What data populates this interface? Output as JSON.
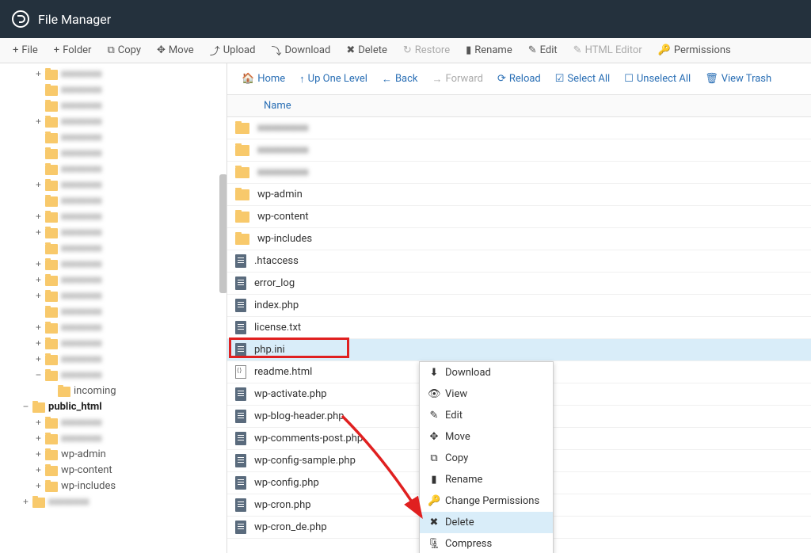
{
  "header": {
    "title": "File Manager"
  },
  "toolbar": {
    "items": [
      {
        "icon": "+",
        "label": "File"
      },
      {
        "icon": "+",
        "label": "Folder"
      },
      {
        "icon": "⧉",
        "label": "Copy"
      },
      {
        "icon": "✥",
        "label": "Move"
      },
      {
        "icon": "⤴",
        "label": "Upload"
      },
      {
        "icon": "⤵",
        "label": "Download"
      },
      {
        "icon": "✖",
        "label": "Delete"
      },
      {
        "icon": "↻",
        "label": "Restore",
        "disabled": true
      },
      {
        "icon": "▮",
        "label": "Rename"
      },
      {
        "icon": "✎",
        "label": "Edit"
      },
      {
        "icon": "✎",
        "label": "HTML Editor",
        "disabled": true
      },
      {
        "icon": "🔑",
        "label": "Permissions"
      }
    ]
  },
  "actionbar": {
    "items": [
      {
        "icon": "🏠",
        "label": "Home"
      },
      {
        "icon": "↑",
        "label": "Up One Level"
      },
      {
        "icon": "←",
        "label": "Back"
      },
      {
        "icon": "→",
        "label": "Forward",
        "disabled": true
      },
      {
        "icon": "⟳",
        "label": "Reload"
      },
      {
        "icon": "☑",
        "label": "Select All"
      },
      {
        "icon": "☐",
        "label": "Unselect All"
      },
      {
        "icon": "🗑",
        "label": "View Trash"
      }
    ]
  },
  "table": {
    "header_name": "Name"
  },
  "sidebar": {
    "nodes": [
      {
        "depth": 2,
        "expander": "+",
        "label": "",
        "blur": true
      },
      {
        "depth": 2,
        "expander": "",
        "label": "",
        "blur": true
      },
      {
        "depth": 2,
        "expander": "",
        "label": "",
        "blur": true
      },
      {
        "depth": 2,
        "expander": "+",
        "label": "",
        "blur": true
      },
      {
        "depth": 2,
        "expander": "",
        "label": "",
        "blur": true
      },
      {
        "depth": 2,
        "expander": "",
        "label": "",
        "blur": true
      },
      {
        "depth": 2,
        "expander": "",
        "label": "",
        "blur": true
      },
      {
        "depth": 2,
        "expander": "+",
        "label": "",
        "blur": true
      },
      {
        "depth": 2,
        "expander": "",
        "label": "",
        "blur": true
      },
      {
        "depth": 2,
        "expander": "+",
        "label": "",
        "blur": true
      },
      {
        "depth": 2,
        "expander": "+",
        "label": "",
        "blur": true
      },
      {
        "depth": 2,
        "expander": "",
        "label": "",
        "blur": true
      },
      {
        "depth": 2,
        "expander": "+",
        "label": "",
        "blur": true
      },
      {
        "depth": 2,
        "expander": "+",
        "label": "",
        "blur": true
      },
      {
        "depth": 2,
        "expander": "+",
        "label": "",
        "blur": true
      },
      {
        "depth": 2,
        "expander": "",
        "label": "",
        "blur": true
      },
      {
        "depth": 2,
        "expander": "+",
        "label": "",
        "blur": true
      },
      {
        "depth": 2,
        "expander": "+",
        "label": "",
        "blur": true
      },
      {
        "depth": 2,
        "expander": "+",
        "label": "",
        "blur": true
      },
      {
        "depth": 2,
        "expander": "−",
        "label": "",
        "blur": true
      },
      {
        "depth": 3,
        "expander": "",
        "label": "incoming"
      },
      {
        "depth": 1,
        "expander": "−",
        "label": "public_html",
        "bold": true
      },
      {
        "depth": 2,
        "expander": "+",
        "label": "",
        "blur": true
      },
      {
        "depth": 2,
        "expander": "+",
        "label": "",
        "blur": true
      },
      {
        "depth": 2,
        "expander": "+",
        "label": "wp-admin"
      },
      {
        "depth": 2,
        "expander": "+",
        "label": "wp-content"
      },
      {
        "depth": 2,
        "expander": "+",
        "label": "wp-includes"
      },
      {
        "depth": 1,
        "expander": "+",
        "label": "",
        "blur": true
      }
    ]
  },
  "files": [
    {
      "type": "folder",
      "name": "",
      "blur": true
    },
    {
      "type": "folder",
      "name": "",
      "blur": true
    },
    {
      "type": "folder",
      "name": "",
      "blur": true
    },
    {
      "type": "folder",
      "name": "wp-admin"
    },
    {
      "type": "folder",
      "name": "wp-content"
    },
    {
      "type": "folder",
      "name": "wp-includes"
    },
    {
      "type": "file",
      "name": ".htaccess"
    },
    {
      "type": "file",
      "name": "error_log"
    },
    {
      "type": "file",
      "name": "index.php"
    },
    {
      "type": "file",
      "name": "license.txt"
    },
    {
      "type": "file",
      "name": "php.ini",
      "selected": true,
      "highlight": true
    },
    {
      "type": "html",
      "name": "readme.html"
    },
    {
      "type": "file",
      "name": "wp-activate.php"
    },
    {
      "type": "file",
      "name": "wp-blog-header.php"
    },
    {
      "type": "file",
      "name": "wp-comments-post.php"
    },
    {
      "type": "file",
      "name": "wp-config-sample.php"
    },
    {
      "type": "file",
      "name": "wp-config.php"
    },
    {
      "type": "file",
      "name": "wp-cron.php"
    },
    {
      "type": "file",
      "name": "wp-cron_de.php"
    }
  ],
  "contextmenu": {
    "items": [
      {
        "icon": "⬇",
        "label": "Download"
      },
      {
        "icon": "👁",
        "label": "View"
      },
      {
        "icon": "✎",
        "label": "Edit"
      },
      {
        "icon": "✥",
        "label": "Move"
      },
      {
        "icon": "⧉",
        "label": "Copy"
      },
      {
        "icon": "▮",
        "label": "Rename"
      },
      {
        "icon": "🔑",
        "label": "Change Permissions"
      },
      {
        "icon": "✖",
        "label": "Delete",
        "hover": true
      },
      {
        "icon": "🗜",
        "label": "Compress"
      }
    ]
  }
}
